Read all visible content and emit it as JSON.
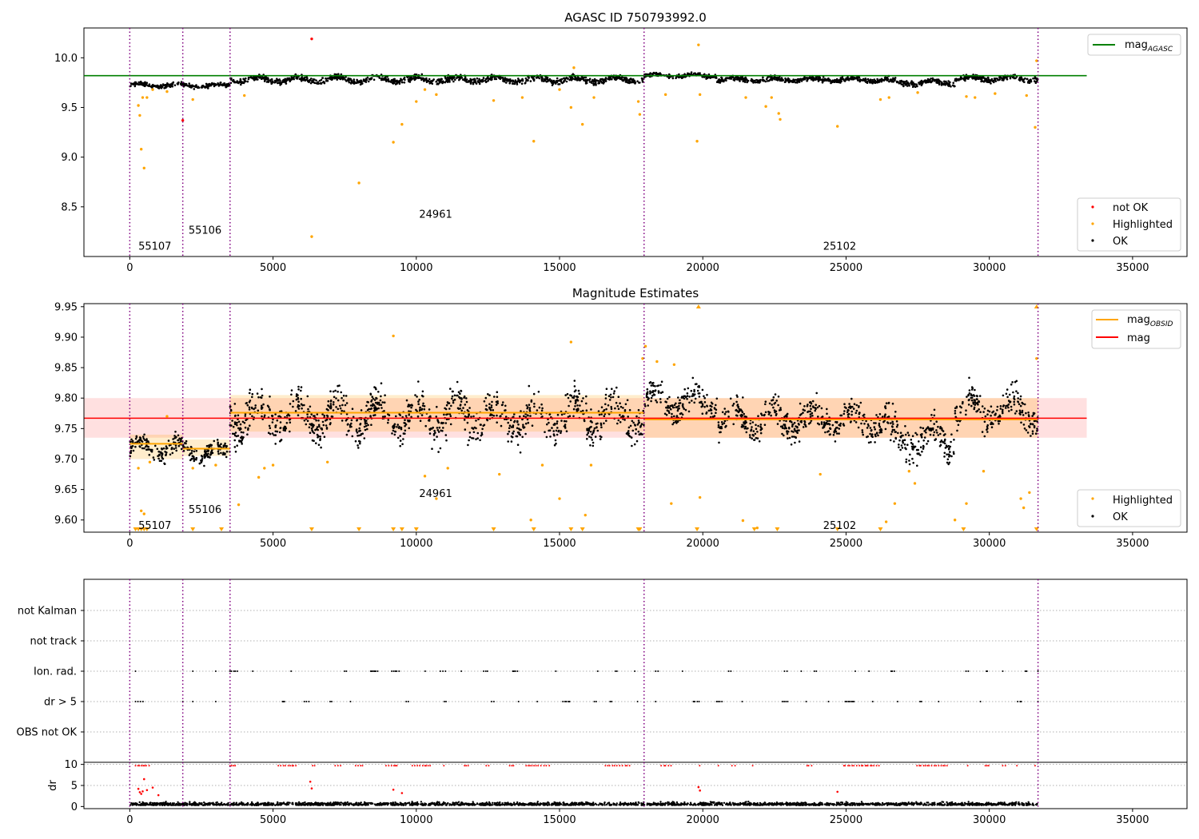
{
  "chart_data": [
    {
      "type": "scatter",
      "title": "AGASC ID 750793992.0",
      "xlim": [
        -1600,
        36900
      ],
      "ylim": [
        8.0,
        10.3
      ],
      "xticks": [
        0,
        5000,
        10000,
        15000,
        20000,
        25000,
        30000,
        35000
      ],
      "yticks": [
        8.5,
        9.0,
        9.5,
        10.0
      ],
      "obs_boundaries": [
        0,
        1850,
        3500,
        17950,
        31700
      ],
      "obsid_labels": [
        {
          "text": "55107",
          "x": 300,
          "y": 8.11
        },
        {
          "text": "55106",
          "x": 2050,
          "y": 8.27
        },
        {
          "text": "24961",
          "x": 10100,
          "y": 8.43
        },
        {
          "text": "25102",
          "x": 24200,
          "y": 8.11
        }
      ],
      "reference_lines": [
        {
          "name": "mag",
          "subscript": "AGASC",
          "y": 9.82,
          "x_range": [
            -1600,
            33400
          ],
          "color": "#008000"
        }
      ],
      "ok_segments": [
        {
          "x": [
            0,
            1850
          ],
          "center": 9.725,
          "spread": 0.03
        },
        {
          "x": [
            1850,
            3500
          ],
          "center": 9.72,
          "spread": 0.03
        },
        {
          "x": [
            3500,
            17950
          ],
          "center": 9.78,
          "spread": 0.045
        },
        {
          "x": [
            17950,
            20500
          ],
          "center": 9.82,
          "spread": 0.03
        },
        {
          "x": [
            20500,
            26500
          ],
          "center": 9.78,
          "spread": 0.035
        },
        {
          "x": [
            26500,
            28800
          ],
          "center": 9.75,
          "spread": 0.04
        },
        {
          "x": [
            28800,
            31700
          ],
          "center": 9.79,
          "spread": 0.04
        }
      ],
      "highlighted_points": [
        [
          300,
          9.52
        ],
        [
          350,
          9.42
        ],
        [
          400,
          9.08
        ],
        [
          450,
          9.6
        ],
        [
          500,
          8.89
        ],
        [
          600,
          9.6
        ],
        [
          800,
          9.68
        ],
        [
          1300,
          9.66
        ],
        [
          2200,
          9.58
        ],
        [
          4000,
          9.62
        ],
        [
          6350,
          8.2
        ],
        [
          8000,
          8.74
        ],
        [
          9200,
          9.15
        ],
        [
          9500,
          9.33
        ],
        [
          10000,
          9.56
        ],
        [
          10300,
          9.68
        ],
        [
          10700,
          9.63
        ],
        [
          12700,
          9.57
        ],
        [
          13700,
          9.6
        ],
        [
          14100,
          9.16
        ],
        [
          15000,
          9.68
        ],
        [
          15400,
          9.5
        ],
        [
          15500,
          9.9
        ],
        [
          15800,
          9.33
        ],
        [
          16200,
          9.6
        ],
        [
          17750,
          9.56
        ],
        [
          17800,
          9.43
        ],
        [
          18700,
          9.63
        ],
        [
          19800,
          9.16
        ],
        [
          19850,
          10.13
        ],
        [
          19900,
          9.63
        ],
        [
          21500,
          9.6
        ],
        [
          22200,
          9.51
        ],
        [
          22400,
          9.6
        ],
        [
          22650,
          9.44
        ],
        [
          22700,
          9.38
        ],
        [
          24700,
          9.31
        ],
        [
          26200,
          9.58
        ],
        [
          26500,
          9.6
        ],
        [
          27500,
          9.65
        ],
        [
          29200,
          9.61
        ],
        [
          29500,
          9.6
        ],
        [
          30200,
          9.64
        ],
        [
          31300,
          9.62
        ],
        [
          31600,
          9.3
        ],
        [
          31650,
          9.97
        ]
      ],
      "not_ok_points": [
        [
          6350,
          10.19
        ],
        [
          1850,
          9.37
        ]
      ],
      "legend": [
        {
          "name": "mag",
          "subscript": "AGASC",
          "color": "#008000",
          "placement": "top-right"
        },
        {
          "name": "not OK",
          "color": "#ff0000",
          "placement": "bottom-right"
        },
        {
          "name": "Highlighted",
          "color": "#ffa500",
          "placement": "bottom-right"
        },
        {
          "name": "OK",
          "color": "#000000",
          "placement": "bottom-right"
        }
      ]
    },
    {
      "type": "scatter",
      "title": "Magnitude Estimates",
      "xlim": [
        -1600,
        36900
      ],
      "ylim": [
        9.58,
        9.955
      ],
      "xticks": [
        0,
        5000,
        10000,
        15000,
        20000,
        25000,
        30000,
        35000
      ],
      "yticks": [
        9.6,
        9.65,
        9.7,
        9.75,
        9.8,
        9.85,
        9.9,
        9.95
      ],
      "obs_boundaries": [
        0,
        1850,
        3500,
        17950,
        31700
      ],
      "obsid_labels": [
        {
          "text": "55107",
          "x": 300,
          "y": 9.592
        },
        {
          "text": "55106",
          "x": 2050,
          "y": 9.618
        },
        {
          "text": "24961",
          "x": 10100,
          "y": 9.644
        },
        {
          "text": "25102",
          "x": 24200,
          "y": 9.592
        }
      ],
      "mag": {
        "name": "mag",
        "value": 9.767,
        "band": [
          9.735,
          9.8
        ],
        "x_range": [
          -1600,
          33400
        ],
        "color": "#ff0000"
      },
      "mag_obsid": [
        {
          "x": [
            0,
            1850
          ],
          "value": 9.725,
          "band": [
            9.7,
            9.74
          ]
        },
        {
          "x": [
            1850,
            3500
          ],
          "value": 9.717,
          "band": [
            9.705,
            9.732
          ]
        },
        {
          "x": [
            3500,
            17950
          ],
          "value": 9.776,
          "band": [
            9.745,
            9.805
          ]
        },
        {
          "x": [
            17950,
            31700
          ],
          "value": 9.765,
          "band": [
            9.735,
            9.8
          ]
        }
      ],
      "ok_segments": [
        {
          "x": [
            0,
            1850
          ],
          "center": 9.718,
          "spread": 0.022
        },
        {
          "x": [
            1850,
            3500
          ],
          "center": 9.712,
          "spread": 0.02
        },
        {
          "x": [
            3500,
            17950
          ],
          "center": 9.77,
          "spread": 0.045
        },
        {
          "x": [
            17950,
            20500
          ],
          "center": 9.795,
          "spread": 0.035
        },
        {
          "x": [
            20500,
            26500
          ],
          "center": 9.765,
          "spread": 0.035
        },
        {
          "x": [
            26500,
            28800
          ],
          "center": 9.735,
          "spread": 0.04
        },
        {
          "x": [
            28800,
            31700
          ],
          "center": 9.78,
          "spread": 0.04
        }
      ],
      "highlighted_points": [
        [
          300,
          9.685
        ],
        [
          400,
          9.615
        ],
        [
          500,
          9.61
        ],
        [
          700,
          9.695
        ],
        [
          1300,
          9.77
        ],
        [
          2200,
          9.685
        ],
        [
          3000,
          9.69
        ],
        [
          3800,
          9.625
        ],
        [
          4500,
          9.67
        ],
        [
          4700,
          9.685
        ],
        [
          5000,
          9.69
        ],
        [
          6900,
          9.695
        ],
        [
          9200,
          9.902
        ],
        [
          10300,
          9.672
        ],
        [
          10700,
          9.635
        ],
        [
          11100,
          9.685
        ],
        [
          12900,
          9.675
        ],
        [
          14000,
          9.6
        ],
        [
          14400,
          9.69
        ],
        [
          15000,
          9.635
        ],
        [
          15400,
          9.892
        ],
        [
          15900,
          9.608
        ],
        [
          16100,
          9.69
        ],
        [
          17900,
          9.865
        ],
        [
          18000,
          9.885
        ],
        [
          18400,
          9.86
        ],
        [
          18900,
          9.627
        ],
        [
          19000,
          9.855
        ],
        [
          19900,
          9.637
        ],
        [
          21400,
          9.599
        ],
        [
          21900,
          9.587
        ],
        [
          24100,
          9.675
        ],
        [
          26400,
          9.597
        ],
        [
          26700,
          9.627
        ],
        [
          27200,
          9.68
        ],
        [
          27400,
          9.66
        ],
        [
          28800,
          9.6
        ],
        [
          29200,
          9.627
        ],
        [
          29800,
          9.68
        ],
        [
          31100,
          9.635
        ],
        [
          31200,
          9.62
        ],
        [
          31400,
          9.645
        ],
        [
          31650,
          9.865
        ]
      ],
      "clipped_low": [
        200,
        300,
        400,
        500,
        600,
        2200,
        3200,
        6350,
        8000,
        9200,
        9500,
        10000,
        12700,
        14100,
        15400,
        15800,
        17750,
        17800,
        19800,
        21800,
        22600,
        24700,
        26200,
        29100,
        31650
      ],
      "clipped_high": [
        19850,
        31650
      ],
      "legend": [
        {
          "name": "mag",
          "subscript": "OBSID",
          "color": "#ffa500",
          "placement": "top-right"
        },
        {
          "name": "mag",
          "color": "#ff0000",
          "placement": "top-right"
        },
        {
          "name": "Highlighted",
          "color": "#ffa500",
          "placement": "bottom-right"
        },
        {
          "name": "OK",
          "color": "#000000",
          "placement": "bottom-right"
        }
      ]
    },
    {
      "type": "scatter",
      "title": "",
      "xlim": [
        -1600,
        36900
      ],
      "flag_labels": [
        "not Kalman",
        "not track",
        "Ion. rad.",
        "dr > 5",
        "OBS not OK"
      ],
      "flags": {
        "Ion. rad.": [
          [
            200,
            800
          ],
          [
            2200,
            2200
          ],
          [
            3000,
            3000
          ],
          [
            3500,
            31500
          ],
          [
            31700,
            31700
          ]
        ],
        "dr > 5": [
          [
            200,
            800
          ],
          [
            1850,
            1850
          ],
          [
            2200,
            2200
          ],
          [
            3000,
            3000
          ],
          [
            3500,
            31500
          ],
          [
            31700,
            31700
          ]
        ],
        "not Kalman": [],
        "not track": [],
        "OBS not OK": []
      },
      "obs_boundaries": [
        0,
        1850,
        3500,
        17950,
        31700
      ]
    },
    {
      "type": "scatter",
      "title": "",
      "ylabel": "dr",
      "xlim": [
        -1600,
        36900
      ],
      "ylim": [
        -0.5,
        10.5
      ],
      "xticks": [
        0,
        5000,
        10000,
        15000,
        20000,
        25000,
        30000,
        35000
      ],
      "yticks": [
        0,
        5,
        10
      ],
      "dr_baseline": {
        "center": 0.6,
        "spread": 0.6
      },
      "dr_outliers": [
        [
          300,
          4.2
        ],
        [
          350,
          3.4
        ],
        [
          400,
          3.0
        ],
        [
          450,
          3.6
        ],
        [
          500,
          6.5
        ],
        [
          600,
          3.9
        ],
        [
          800,
          4.5
        ],
        [
          1000,
          2.7
        ],
        [
          6300,
          5.9
        ],
        [
          6350,
          4.3
        ],
        [
          9200,
          4.0
        ],
        [
          9500,
          3.2
        ],
        [
          19850,
          4.6
        ],
        [
          19900,
          3.8
        ],
        [
          24700,
          3.5
        ]
      ],
      "dr_clipped_from": 3500,
      "obs_boundaries": [
        0,
        1850,
        3500,
        17950,
        31700
      ]
    }
  ]
}
